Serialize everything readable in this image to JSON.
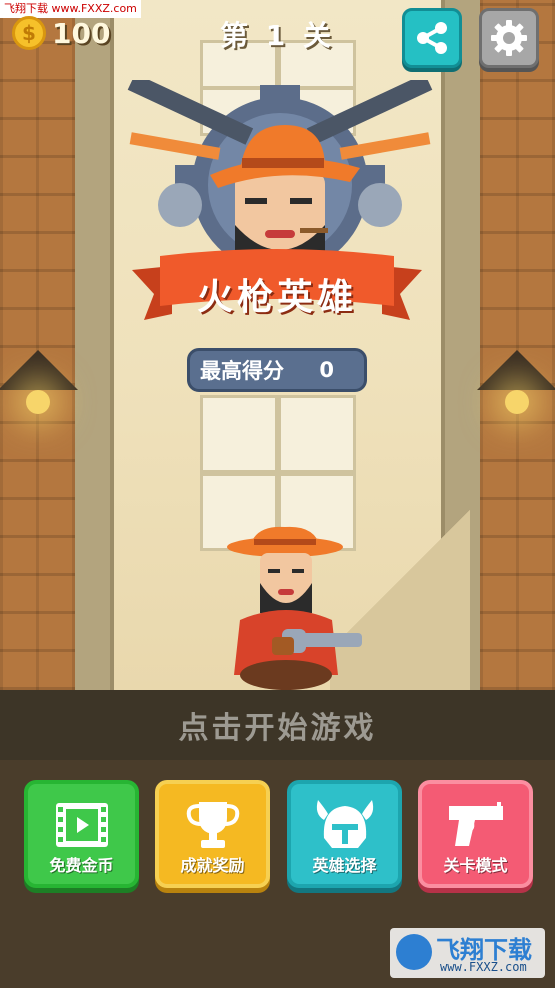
{
  "watermark_top": "飞翔下载 www.FXXZ.com",
  "coins": {
    "count": "100"
  },
  "level": {
    "title": "第 1 关"
  },
  "game": {
    "title": "火枪英雄"
  },
  "score": {
    "label": "最高得分",
    "value": "0"
  },
  "start_prompt": "点击开始游戏",
  "menu": [
    {
      "label": "免费金币",
      "icon": "film-icon"
    },
    {
      "label": "成就奖励",
      "icon": "trophy-icon"
    },
    {
      "label": "英雄选择",
      "icon": "helmet-icon"
    },
    {
      "label": "关卡模式",
      "icon": "pistol-icon"
    }
  ],
  "watermark_logo": {
    "name": "飞翔下载",
    "url": "www.FXXZ.com"
  },
  "colors": {
    "share": "#25c0c4",
    "settings": "#a7a7a7",
    "free_coins": "#3fc84a",
    "achievements": "#f5b922",
    "hero_select": "#2ec0c9",
    "level_mode": "#f45b74",
    "ribbon": "#f05a2b"
  }
}
